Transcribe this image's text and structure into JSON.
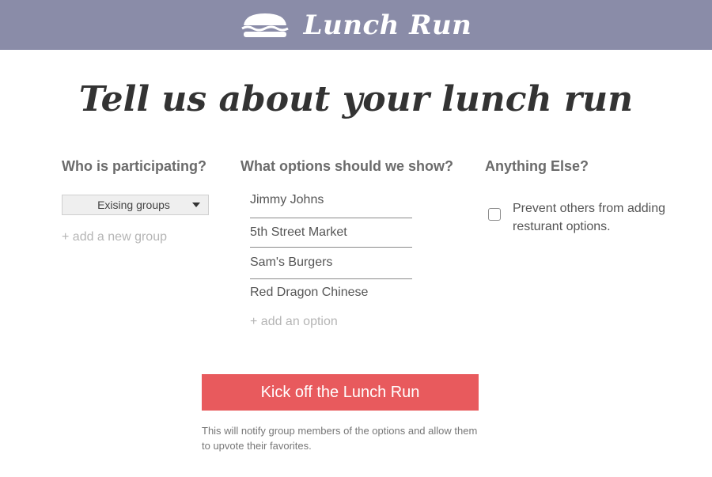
{
  "header": {
    "logo_icon": "sandwich-icon",
    "brand_name": "Lunch Run",
    "bg_color": "#8a8ca8"
  },
  "page_title": "Tell us about your lunch run",
  "participants": {
    "heading": "Who is participating?",
    "group_select": "Exising groups",
    "add_group_link": "+ add a new group"
  },
  "options": {
    "heading": "What options should we show?",
    "items": [
      "Jimmy Johns",
      "5th Street Market",
      "Sam's Burgers",
      "Red Dragon Chinese"
    ],
    "add_option_link": "+ add an option"
  },
  "extras": {
    "heading": "Anything Else?",
    "prevent_label": "Prevent others from adding resturant options.",
    "prevent_checked": false
  },
  "cta": {
    "label": "Kick off the Lunch Run",
    "note": "This will notify group members of the options and allow them to upvote their favorites.",
    "color": "#e85a5d"
  }
}
